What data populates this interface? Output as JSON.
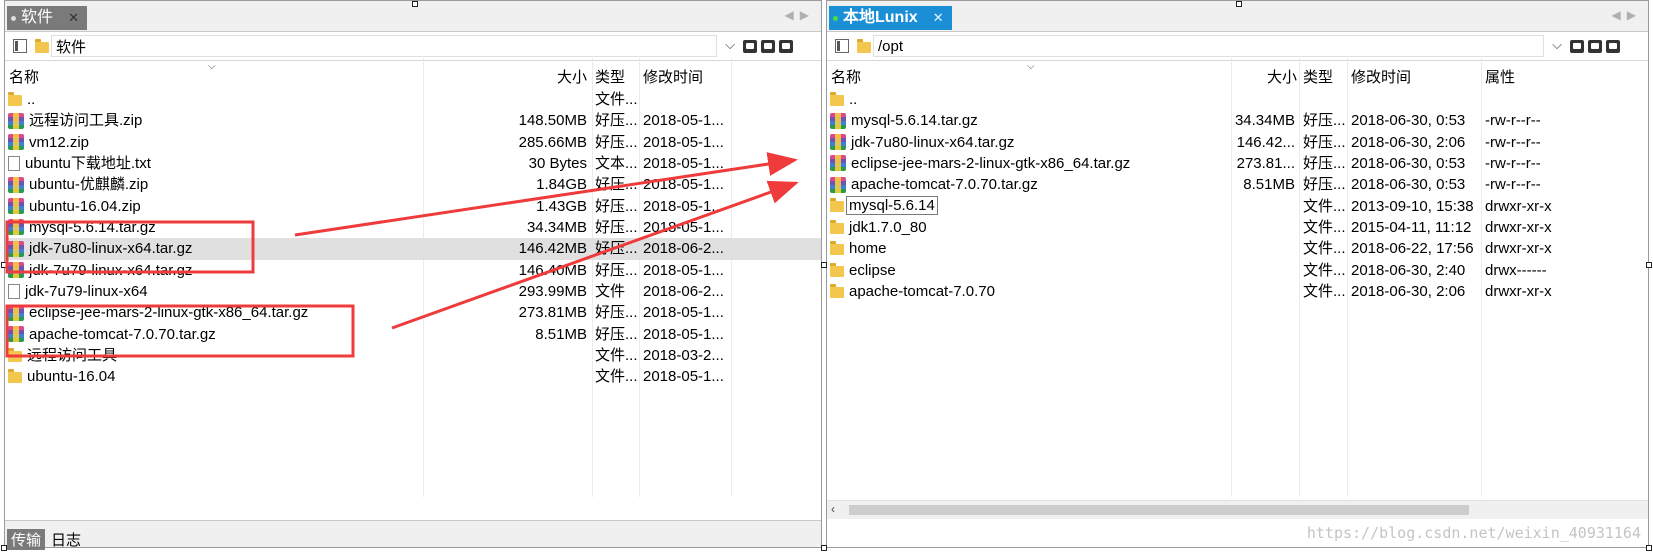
{
  "colors": {
    "active_tab": "#1a8fd6",
    "inactive_tab": "#7a7a7a",
    "annotation_red": "#ef3b3b"
  },
  "left": {
    "tab_label": "软件",
    "tab_close": "✕",
    "path": "软件",
    "columns": {
      "name": "名称",
      "size": "大小",
      "type": "类型",
      "modified": "修改时间"
    },
    "rows": [
      {
        "icon": "folder-icon",
        "name": "..",
        "size": "",
        "type": "文件...",
        "modified": ""
      },
      {
        "icon": "archive-icon",
        "name": "远程访问工具.zip",
        "size": "148.50MB",
        "type": "好压...",
        "modified": "2018-05-1..."
      },
      {
        "icon": "archive-icon",
        "name": "vm12.zip",
        "size": "285.66MB",
        "type": "好压...",
        "modified": "2018-05-1..."
      },
      {
        "icon": "file-icon",
        "name": "ubuntu下载地址.txt",
        "size": "30 Bytes",
        "type": "文本...",
        "modified": "2018-05-1..."
      },
      {
        "icon": "archive-icon",
        "name": "ubuntu-优麒麟.zip",
        "size": "1.84GB",
        "type": "好压...",
        "modified": "2018-05-1..."
      },
      {
        "icon": "archive-icon",
        "name": "ubuntu-16.04.zip",
        "size": "1.43GB",
        "type": "好压...",
        "modified": "2018-05-1..."
      },
      {
        "icon": "archive-icon",
        "name": "mysql-5.6.14.tar.gz",
        "size": "34.34MB",
        "type": "好压...",
        "modified": "2018-05-1..."
      },
      {
        "icon": "archive-icon",
        "name": "jdk-7u80-linux-x64.tar.gz",
        "size": "146.42MB",
        "type": "好压...",
        "modified": "2018-06-2...",
        "selected": true
      },
      {
        "icon": "archive-icon",
        "name": "jdk-7u79-linux-x64.tar.gz",
        "size": "146.40MB",
        "type": "好压...",
        "modified": "2018-05-1..."
      },
      {
        "icon": "file-icon",
        "name": "jdk-7u79-linux-x64",
        "size": "293.99MB",
        "type": "文件",
        "modified": "2018-06-2..."
      },
      {
        "icon": "archive-icon",
        "name": "eclipse-jee-mars-2-linux-gtk-x86_64.tar.gz",
        "size": "273.81MB",
        "type": "好压...",
        "modified": "2018-05-1..."
      },
      {
        "icon": "archive-icon",
        "name": "apache-tomcat-7.0.70.tar.gz",
        "size": "8.51MB",
        "type": "好压...",
        "modified": "2018-05-1..."
      },
      {
        "icon": "folder-icon",
        "name": "远程访问工具",
        "size": "",
        "type": "文件...",
        "modified": "2018-03-2..."
      },
      {
        "icon": "folder-icon",
        "name": "ubuntu-16.04",
        "size": "",
        "type": "文件...",
        "modified": "2018-05-1..."
      }
    ],
    "bottom_tabs": [
      "传输",
      "日志"
    ]
  },
  "right": {
    "tab_label": "本地Lunix",
    "tab_close": "✕",
    "path": "/opt",
    "columns": {
      "name": "名称",
      "size": "大小",
      "type": "类型",
      "modified": "修改时间",
      "attrs": "属性"
    },
    "rows": [
      {
        "icon": "folder-icon",
        "name": "..",
        "size": "",
        "type": "",
        "modified": "",
        "attrs": ""
      },
      {
        "icon": "archive-icon",
        "name": "mysql-5.6.14.tar.gz",
        "size": "34.34MB",
        "type": "好压...",
        "modified": "2018-06-30, 0:53",
        "attrs": "-rw-r--r--"
      },
      {
        "icon": "archive-icon",
        "name": "jdk-7u80-linux-x64.tar.gz",
        "size": "146.42...",
        "type": "好压...",
        "modified": "2018-06-30, 2:06",
        "attrs": "-rw-r--r--"
      },
      {
        "icon": "archive-icon",
        "name": "eclipse-jee-mars-2-linux-gtk-x86_64.tar.gz",
        "size": "273.81...",
        "type": "好压...",
        "modified": "2018-06-30, 0:53",
        "attrs": "-rw-r--r--"
      },
      {
        "icon": "archive-icon",
        "name": "apache-tomcat-7.0.70.tar.gz",
        "size": "8.51MB",
        "type": "好压...",
        "modified": "2018-06-30, 0:53",
        "attrs": "-rw-r--r--"
      },
      {
        "icon": "folder-icon",
        "name": "mysql-5.6.14",
        "size": "",
        "type": "文件...",
        "modified": "2013-09-10, 15:38",
        "attrs": "drwxr-xr-x",
        "focused": true
      },
      {
        "icon": "folder-icon",
        "name": "jdk1.7.0_80",
        "size": "",
        "type": "文件...",
        "modified": "2015-04-11, 11:12",
        "attrs": "drwxr-xr-x"
      },
      {
        "icon": "folder-icon",
        "name": "home",
        "size": "",
        "type": "文件...",
        "modified": "2018-06-22, 17:56",
        "attrs": "drwxr-xr-x"
      },
      {
        "icon": "folder-icon",
        "name": "eclipse",
        "size": "",
        "type": "文件...",
        "modified": "2018-06-30, 2:40",
        "attrs": "drwx------"
      },
      {
        "icon": "folder-icon",
        "name": "apache-tomcat-7.0.70",
        "size": "",
        "type": "文件...",
        "modified": "2018-06-30, 2:06",
        "attrs": "drwxr-xr-x"
      }
    ]
  },
  "watermark": "https://blog.csdn.net/weixin_40931164"
}
